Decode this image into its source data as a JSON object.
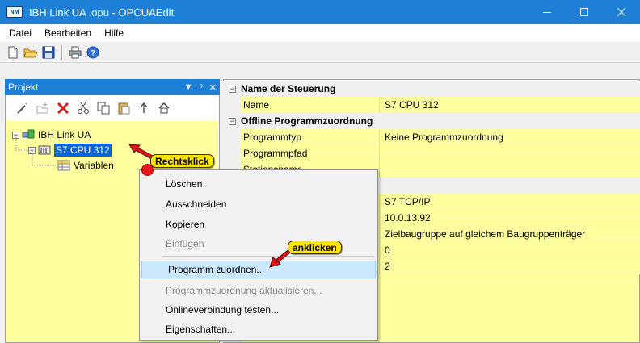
{
  "window": {
    "title": "IBH Link UA .opu - OPCUAEdit",
    "icon_label": "NM",
    "minimize_icon": "minimize-icon",
    "maximize_icon": "maximize-icon",
    "close_icon": "close-icon"
  },
  "menu": {
    "items": [
      "Datei",
      "Bearbeiten",
      "Hilfe"
    ]
  },
  "toolbar": {
    "icons": [
      "new-file-icon",
      "open-folder-icon",
      "save-icon",
      "print-icon",
      "help-icon"
    ]
  },
  "project_panel": {
    "title": "Projekt",
    "controls": [
      "▼",
      "ᵖ",
      "✕"
    ],
    "toolbar_icons": [
      "wand-icon",
      "add-disabled-icon",
      "delete-icon",
      "cut-icon",
      "copy-icon",
      "paste-icon",
      "arrow-up-icon",
      "home-icon"
    ],
    "tree": {
      "root": "IBH Link UA",
      "cpu": "S7 CPU 312",
      "variables": "Variablen"
    }
  },
  "properties": {
    "categories": [
      {
        "label": "Name der Steuerung",
        "rows": [
          {
            "name": "Name",
            "value": "S7 CPU 312"
          }
        ]
      },
      {
        "label": "Offline Programmzuordnung",
        "rows": [
          {
            "name": "Programmtyp",
            "value": "Keine Programmzuordnung"
          },
          {
            "name": "Programmpfad",
            "value": ""
          },
          {
            "name": "Stationsname",
            "value": ""
          }
        ]
      }
    ],
    "connection_values": [
      "S7 TCP/IP",
      "10.0.13.92",
      "Zielbaugruppe auf gleichem Baugruppenträger",
      "0",
      "2"
    ]
  },
  "context_menu": {
    "items": [
      {
        "label": "Löschen",
        "enabled": true
      },
      {
        "label": "Ausschneiden",
        "enabled": true
      },
      {
        "label": "Kopieren",
        "enabled": true
      },
      {
        "label": "Einfügen",
        "enabled": false
      },
      {
        "label": "Programm zuordnen...",
        "enabled": true,
        "highlighted": true
      },
      {
        "label": "Programmzuordnung aktualisieren...",
        "enabled": false
      },
      {
        "label": "Onlineverbindung testen...",
        "enabled": true
      },
      {
        "label": "Eigenschaften...",
        "enabled": true
      }
    ]
  },
  "annotations": {
    "rechtsklick": "Rechtsklick",
    "anklicken": "anklicken",
    "callout_color": "#ffe600",
    "arrow_color": "#e4151b"
  }
}
